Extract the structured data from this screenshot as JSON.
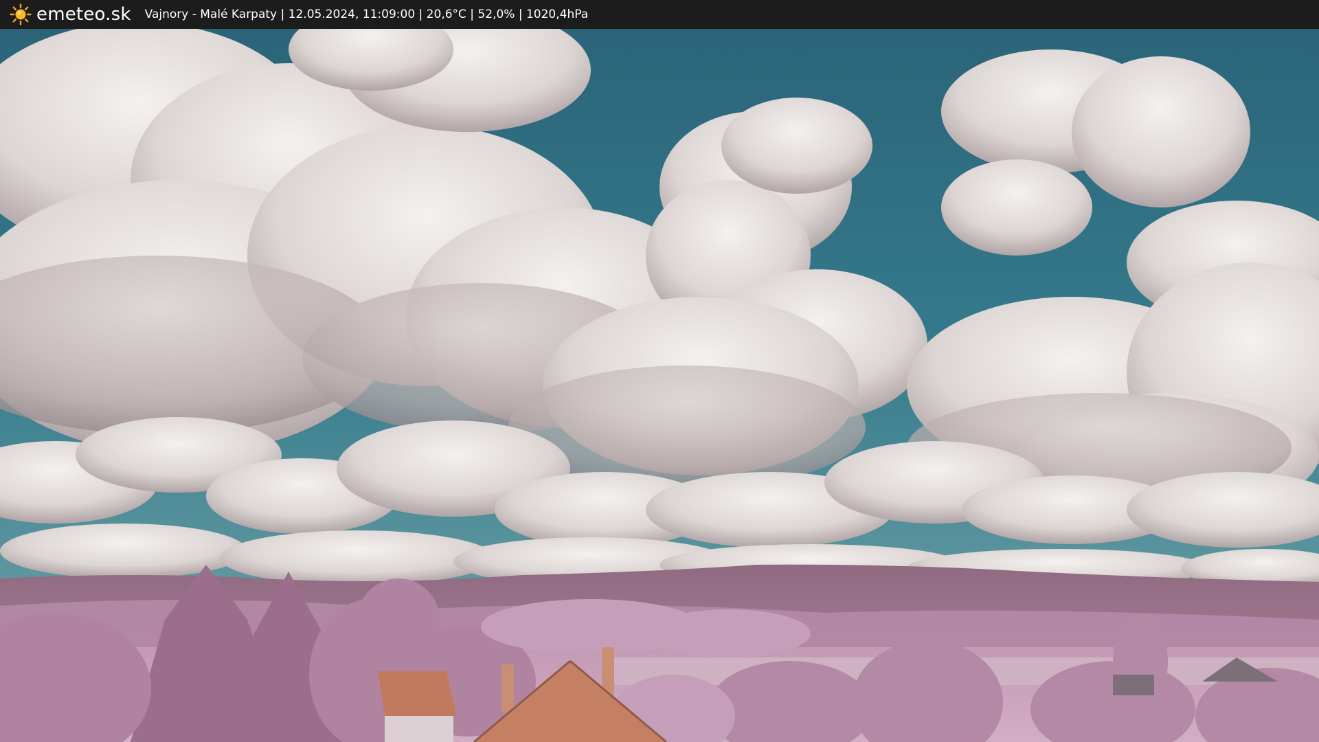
{
  "header": {
    "brand": "emeteo.sk",
    "caption": "Vajnory - Malé Karpaty | 12.05.2024, 11:09:00 | 20,6°C | 52,0% | 1020,4hPa",
    "logo_icon": "sun-icon"
  },
  "colors": {
    "bar": "#1c1c1c",
    "sky": "#2f6f84",
    "cloud": "#e9e4e2",
    "foliage": "#c49ab8",
    "roof": "#c27a5e"
  }
}
